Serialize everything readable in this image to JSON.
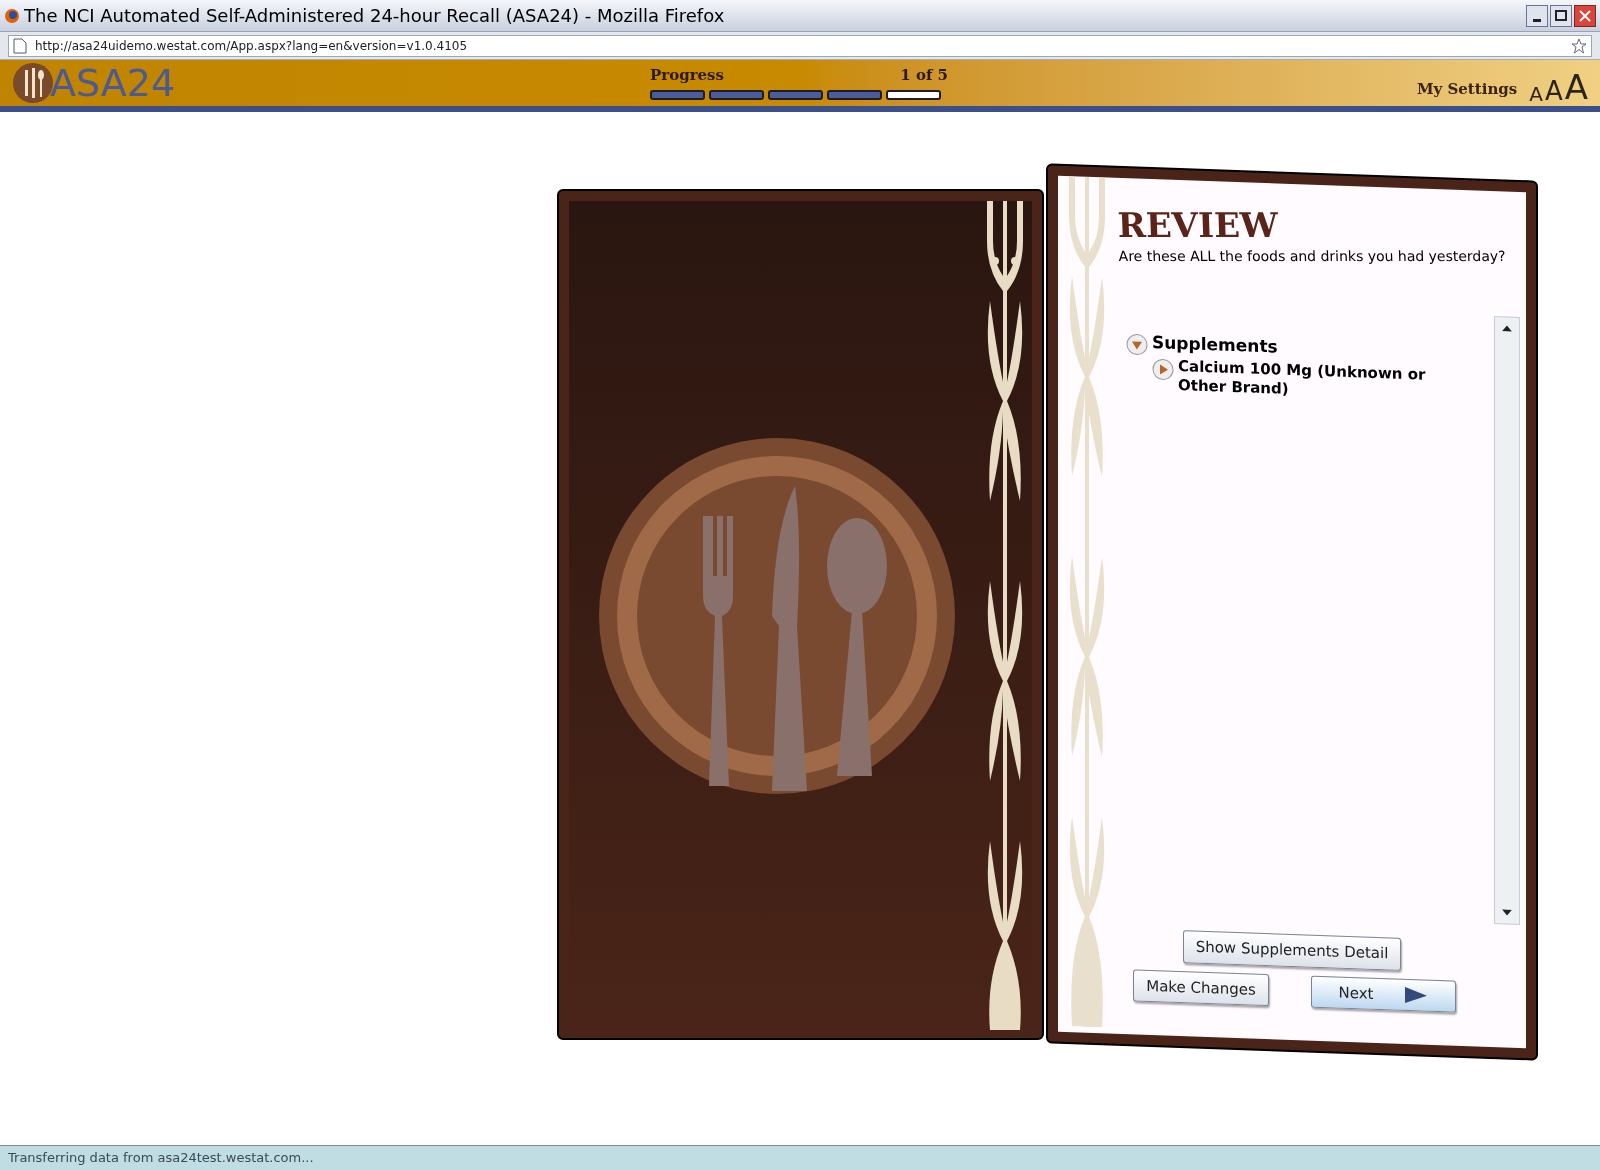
{
  "window": {
    "title": "The NCI Automated Self-Administered 24-hour Recall (ASA24) - Mozilla Firefox"
  },
  "address_bar": {
    "url": "http://asa24uidemo.westat.com/App.aspx?lang=en&version=v1.0.4105"
  },
  "header": {
    "logo_text": "ASA24",
    "progress_label": "Progress",
    "progress_count": "1 of 5",
    "progress_segments": [
      {
        "filled": true
      },
      {
        "filled": true
      },
      {
        "filled": true
      },
      {
        "filled": true
      },
      {
        "filled": false
      }
    ],
    "settings_link": "My Settings",
    "text_size_options": [
      "A",
      "A",
      "A"
    ]
  },
  "review": {
    "title": "REVIEW",
    "question": "Are these ALL the foods and drinks you had yesterday?",
    "tree": [
      {
        "label": "Supplements",
        "expanded": true,
        "children": [
          {
            "label": "Calcium 100 Mg (Unknown or Other Brand)",
            "expanded": false
          }
        ]
      }
    ],
    "buttons": [
      {
        "label": "Show Supplements Detail",
        "kind": "plain"
      },
      {
        "label": "Make Changes",
        "kind": "plain"
      },
      {
        "label": "Next",
        "kind": "next"
      }
    ]
  },
  "status_bar": {
    "text": "Transferring data from asa24test.westat.com..."
  }
}
